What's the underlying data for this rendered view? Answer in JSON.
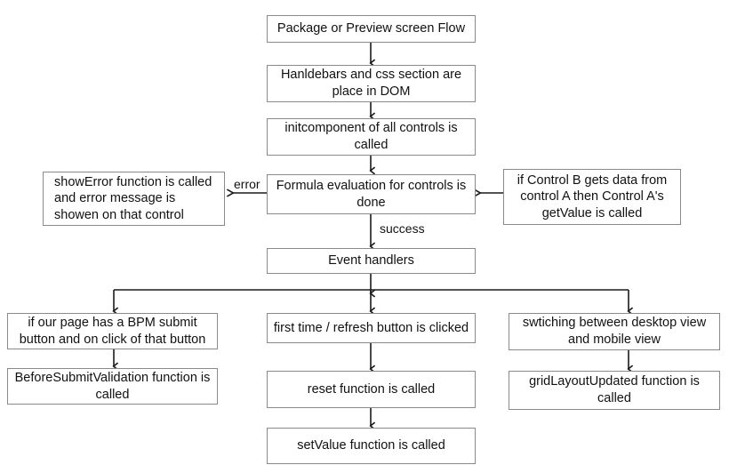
{
  "diagram": {
    "title": "Package or Preview screen Flow",
    "nodes": {
      "package_preview": "Package or Preview screen Flow",
      "handlebars_css": "Hanldebars and css section are place in DOM",
      "initcomponent": "initcomponent of all controls is called",
      "formula_evaluation": "Formula evaluation for controls is done",
      "show_error": "showError function is called and error message is showen on that control",
      "control_b_getdata": "if Control B gets data from control A then Control A's getValue is called",
      "event_handlers": "Event handlers",
      "bpm_submit": "if our page has a BPM submit button and on click of that button",
      "before_submit_validation": "BeforeSubmitValidation function is called",
      "first_time_refresh": "first time / refresh button is clicked",
      "reset_function": "reset function is called",
      "setvalue_function": "setValue function is called",
      "switching_views": "swtiching between desktop view and mobile view",
      "gridlayout_updated": "gridLayoutUpdated function is called"
    },
    "edge_labels": {
      "error": "error",
      "success": "success"
    },
    "colors": {
      "box_border": "#8a8a8a",
      "line": "#1a1a1a",
      "text": "#111111",
      "background": "#ffffff"
    }
  }
}
